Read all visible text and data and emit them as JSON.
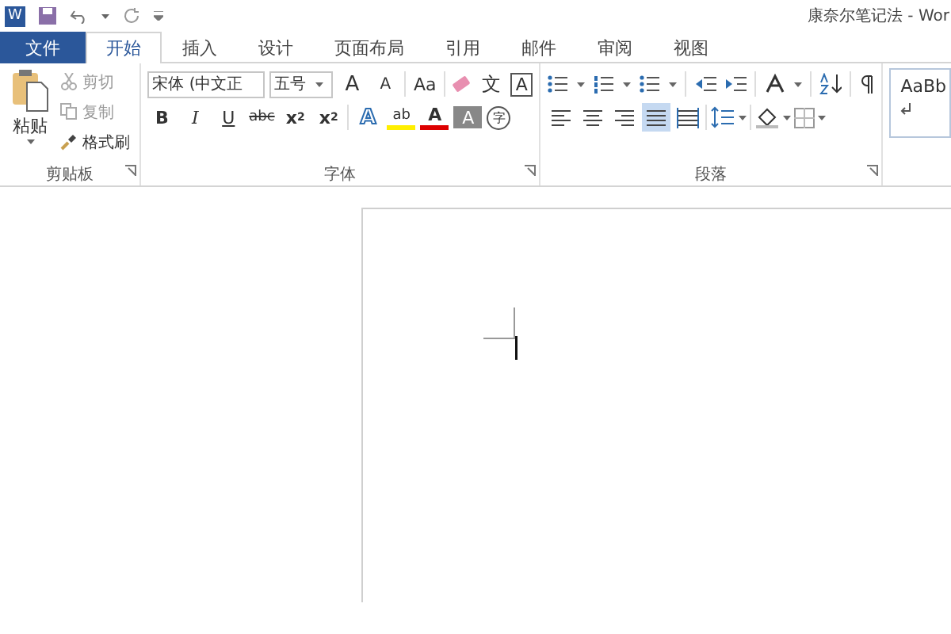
{
  "window": {
    "title": "康奈尔笔记法 - Wor",
    "logo": "W"
  },
  "tabs": [
    {
      "label": "文件",
      "kind": "file",
      "selected": false
    },
    {
      "label": "开始",
      "kind": "tab",
      "selected": true
    },
    {
      "label": "插入",
      "kind": "tab",
      "selected": false
    },
    {
      "label": "设计",
      "kind": "tab",
      "selected": false
    },
    {
      "label": "页面布局",
      "kind": "tab",
      "selected": false
    },
    {
      "label": "引用",
      "kind": "tab",
      "selected": false
    },
    {
      "label": "邮件",
      "kind": "tab",
      "selected": false
    },
    {
      "label": "审阅",
      "kind": "tab",
      "selected": false
    },
    {
      "label": "视图",
      "kind": "tab",
      "selected": false
    }
  ],
  "clipboard": {
    "label": "剪贴板",
    "paste": "粘贴",
    "items": [
      {
        "label": "剪切",
        "kind": "cut",
        "disabled": true
      },
      {
        "label": "复制",
        "kind": "copy",
        "disabled": true
      },
      {
        "label": "格式刷",
        "kind": "brush",
        "disabled": false
      }
    ]
  },
  "font": {
    "label": "字体",
    "font_name": "宋体 (中文正",
    "font_size": "五号",
    "row1": [
      {
        "kind": "grow",
        "text": "A"
      },
      {
        "kind": "shrink",
        "text": "A"
      },
      {
        "kind": "sep"
      },
      {
        "kind": "case",
        "text": "Aa"
      },
      {
        "kind": "sep"
      },
      {
        "kind": "eraser"
      },
      {
        "kind": "phonetic",
        "text": "文"
      },
      {
        "kind": "boxed",
        "text": "A"
      }
    ],
    "row2": [
      {
        "kind": "bold",
        "text": "B"
      },
      {
        "kind": "italic",
        "text": "I"
      },
      {
        "kind": "underline",
        "text": "U"
      },
      {
        "kind": "strike",
        "text": "abc"
      },
      {
        "kind": "sub",
        "text": "x",
        "index": "2"
      },
      {
        "kind": "sup",
        "text": "x",
        "index": "2"
      },
      {
        "kind": "sep"
      },
      {
        "kind": "effect",
        "text": "A"
      },
      {
        "kind": "highlight",
        "text": "ab"
      },
      {
        "kind": "color",
        "text": "A"
      },
      {
        "kind": "shaded",
        "text": "A"
      },
      {
        "kind": "circled",
        "text": "字"
      }
    ]
  },
  "paragraph": {
    "label": "段落",
    "alignment": [
      {
        "kind": "left",
        "selected": false
      },
      {
        "kind": "center",
        "selected": false
      },
      {
        "kind": "right",
        "selected": false
      },
      {
        "kind": "justify",
        "selected": true
      },
      {
        "kind": "distributed",
        "selected": false
      }
    ]
  },
  "styles": {
    "preview": "AaBb"
  }
}
